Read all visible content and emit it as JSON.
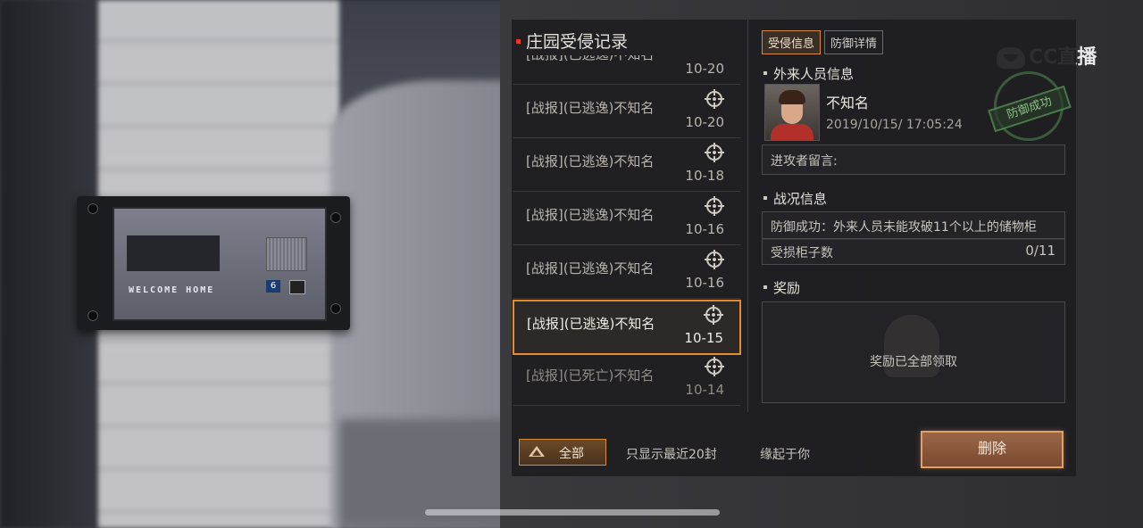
{
  "panel": {
    "title": "庄园受侵记录",
    "records": [
      {
        "name": "[战报](已逃逸)不知名",
        "date": "10-20",
        "state": "normal"
      },
      {
        "name": "[战报](已逃逸)不知名",
        "date": "10-20",
        "state": "normal"
      },
      {
        "name": "[战报](已逃逸)不知名",
        "date": "10-18",
        "state": "normal"
      },
      {
        "name": "[战报](已逃逸)不知名",
        "date": "10-16",
        "state": "normal"
      },
      {
        "name": "[战报](已逃逸)不知名",
        "date": "10-16",
        "state": "normal"
      },
      {
        "name": "[战报](已逃逸)不知名",
        "date": "10-15",
        "state": "selected"
      },
      {
        "name": "[战报](已死亡)不知名",
        "date": "10-14",
        "state": "dim"
      }
    ],
    "filter_label": "全部",
    "limit_note": "只显示最近20封",
    "signature": "缘起于你"
  },
  "detail": {
    "tabs": [
      "受侵信息",
      "防御详情"
    ],
    "active_tab": "受侵信息",
    "visitor_section": "外来人员信息",
    "visitor_name": "不知名",
    "visitor_time": "2019/10/15/ 17:05:24",
    "message_label": "进攻者留言:",
    "battle_section": "战况信息",
    "battle_result": "防御成功：外来人员未能攻破11个以上的储物柜",
    "damaged_label": "受损柜子数",
    "damaged_value": "0/11",
    "reward_section": "奖励",
    "reward_status": "奖励已全部领取",
    "stamp_text": "防御成功",
    "delete_label": "删除"
  },
  "intercom": {
    "welcome_text": "WELCOME HOME",
    "button_label": "6"
  },
  "watermark": {
    "text": "CC直播"
  },
  "colors": {
    "accent": "#d68b3a",
    "selected_border": "#e58a2e",
    "title_dot": "#e23b2b",
    "stamp_green": "#8fbf8a"
  }
}
